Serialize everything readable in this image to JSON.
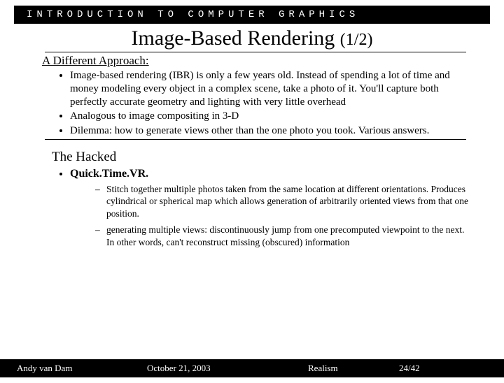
{
  "header": "INTRODUCTION TO COMPUTER GRAPHICS",
  "title_main": "Image-Based Rendering ",
  "title_count": "(1/2)",
  "section1_head": "A Different Approach:",
  "bullets1": {
    "b0": "Image-based rendering (IBR) is only a few years old. Instead of spending a lot of time and money modeling every object in a complex scene, take a photo of it.  You'll capture both perfectly accurate geometry and lighting with very little overhead",
    "b1": "Analogous to image compositing in 3-D",
    "b2": "Dilemma: how to generate views other than the one photo you took. Various answers."
  },
  "section2_head": "The Hacked",
  "mid_label": "Quick.Time.VR.",
  "sub": {
    "s0": "Stitch together multiple photos taken from the same location at different orientations.  Produces cylindrical or spherical map which allows generation of arbitrarily oriented views from that one position.",
    "s1": "generating multiple views: discontinuously jump from one precomputed viewpoint to the next.  In other words, can't reconstruct missing (obscured) information"
  },
  "footer": {
    "author": "Andy van Dam",
    "date": "October 21, 2003",
    "topic": "Realism",
    "page": "24/42"
  }
}
